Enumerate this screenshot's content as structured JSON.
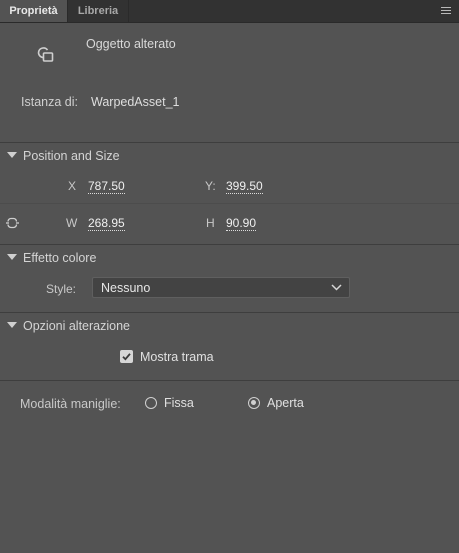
{
  "tabs": [
    {
      "label": "Proprietà",
      "active": true
    },
    {
      "label": "Libreria",
      "active": false
    }
  ],
  "header": {
    "type_label": "Oggetto alterato",
    "instance_label": "Istanza di:",
    "instance_value": "WarpedAsset_1"
  },
  "position_size": {
    "title": "Position and Size",
    "x_label": "X",
    "x_value": "787.50",
    "y_label": "Y:",
    "y_value": "399.50",
    "w_label": "W",
    "w_value": "268.95",
    "h_label": "H",
    "h_value": "90.90"
  },
  "color_effect": {
    "title": "Effetto colore",
    "style_label": "Style:",
    "style_value": "Nessuno"
  },
  "warp_options": {
    "title": "Opzioni alterazione",
    "show_mesh_label": "Mostra trama",
    "show_mesh_checked": true,
    "handles_mode_label": "Modalità maniglie:",
    "option_fixed": "Fissa",
    "option_open": "Aperta",
    "selected": "Aperta"
  },
  "colors": {
    "panel_bg": "#535353",
    "tabbar_bg": "#323232",
    "text": "#d6d6d6"
  }
}
